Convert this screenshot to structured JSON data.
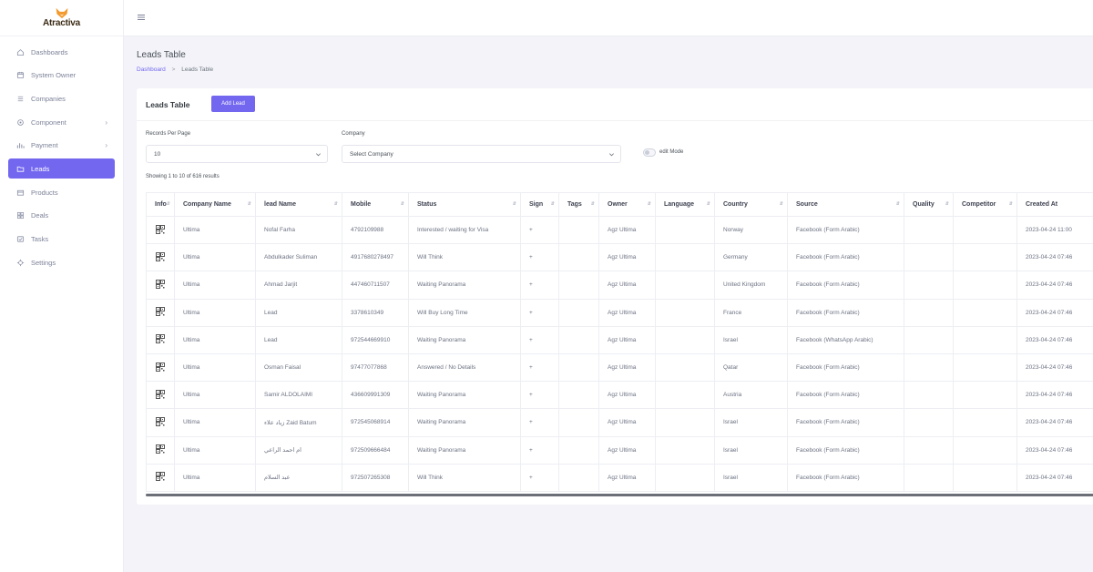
{
  "brand": {
    "name": "Atractiva"
  },
  "sidebar": {
    "items": [
      {
        "label": "Dashboards",
        "icon": "home-icon",
        "chevron": false,
        "active": false
      },
      {
        "label": "System Owner",
        "icon": "calendar-icon",
        "chevron": false,
        "active": false
      },
      {
        "label": "Companies",
        "icon": "list-icon",
        "chevron": false,
        "active": false
      },
      {
        "label": "Component",
        "icon": "settings-icon",
        "chevron": true,
        "active": false
      },
      {
        "label": "Payment",
        "icon": "chart-icon",
        "chevron": true,
        "active": false
      },
      {
        "label": "Leads",
        "icon": "folder-icon",
        "chevron": false,
        "active": true
      },
      {
        "label": "Products",
        "icon": "box-icon",
        "chevron": false,
        "active": false
      },
      {
        "label": "Deals",
        "icon": "grid-icon",
        "chevron": false,
        "active": false
      },
      {
        "label": "Tasks",
        "icon": "task-icon",
        "chevron": false,
        "active": false
      },
      {
        "label": "Settings",
        "icon": "gear-icon",
        "chevron": false,
        "active": false
      }
    ]
  },
  "header": {
    "title": "Leads Table",
    "breadcrumb": {
      "home": "Dashboard",
      "separator": ">",
      "current": "Leads Table"
    }
  },
  "card": {
    "title": "Leads Table",
    "add_button": "Add Lead",
    "records_label": "Records Per Page",
    "records_value": "10",
    "company_label": "Company",
    "company_value": "Select Company",
    "edit_mode_label": "edit Mode",
    "showing": "Showing 1 to 10 of 616 results"
  },
  "table": {
    "columns": [
      "Info",
      "Company Name",
      "lead Name",
      "Mobile",
      "Status",
      "Sign",
      "Tags",
      "Owner",
      "Language",
      "Country",
      "Source",
      "Quality",
      "Competitor",
      "Created At"
    ],
    "rows": [
      [
        "Ultima",
        "Nofal Farha",
        "4792109988",
        "Interested / waiting for Visa",
        "+",
        "",
        "Agz Ultima",
        "",
        "Norway",
        "Facebook (Form Arabic)",
        "",
        "",
        "2023-04-24 11:00"
      ],
      [
        "Ultima",
        "Abdulkader Suliman",
        "4917680278497",
        "Will Think",
        "+",
        "",
        "Agz Ultima",
        "",
        "Germany",
        "Facebook (Form Arabic)",
        "",
        "",
        "2023-04-24 07:46"
      ],
      [
        "Ultima",
        "Ahmad Jarjit",
        "447460711507",
        "Waiting Panorama",
        "+",
        "",
        "Agz Ultima",
        "",
        "United Kingdom",
        "Facebook (Form Arabic)",
        "",
        "",
        "2023-04-24 07:46"
      ],
      [
        "Ultima",
        "Lead",
        "3378610349",
        "Will Buy Long Time",
        "+",
        "",
        "Agz Ultima",
        "",
        "France",
        "Facebook (Form Arabic)",
        "",
        "",
        "2023-04-24 07:46"
      ],
      [
        "Ultima",
        "Lead",
        "972544669910",
        "Waiting Panorama",
        "+",
        "",
        "Agz Ultima",
        "",
        "Israel",
        "Facebook (WhatsApp Arabic)",
        "",
        "",
        "2023-04-24 07:46"
      ],
      [
        "Ultima",
        "Osman Faisal",
        "97477077868",
        "Answered / No Details",
        "+",
        "",
        "Agz Ultima",
        "",
        "Qatar",
        "Facebook (Form Arabic)",
        "",
        "",
        "2023-04-24 07:46"
      ],
      [
        "Ultima",
        "Samir ALDOLAIMI",
        "436609991309",
        "Waiting Panorama",
        "+",
        "",
        "Agz Ultima",
        "",
        "Austria",
        "Facebook (Form Arabic)",
        "",
        "",
        "2023-04-24 07:46"
      ],
      [
        "Ultima",
        "زياد علاء Zaid Batum",
        "972545068914",
        "Waiting Panorama",
        "+",
        "",
        "Agz Ultima",
        "",
        "Israel",
        "Facebook (Form Arabic)",
        "",
        "",
        "2023-04-24 07:46"
      ],
      [
        "Ultima",
        "ام احمد الراعي",
        "972509666484",
        "Waiting Panorama",
        "+",
        "",
        "Agz Ultima",
        "",
        "Israel",
        "Facebook (Form Arabic)",
        "",
        "",
        "2023-04-24 07:46"
      ],
      [
        "Ultima",
        "عبد السلام",
        "972507265308",
        "Will Think",
        "+",
        "",
        "Agz Ultima",
        "",
        "Israel",
        "Facebook (Form Arabic)",
        "",
        "",
        "2023-04-24 07:46"
      ]
    ]
  },
  "colors": {
    "accent": "#7367f0",
    "background": "#f3f3f9",
    "logo": "#f29a2e"
  }
}
